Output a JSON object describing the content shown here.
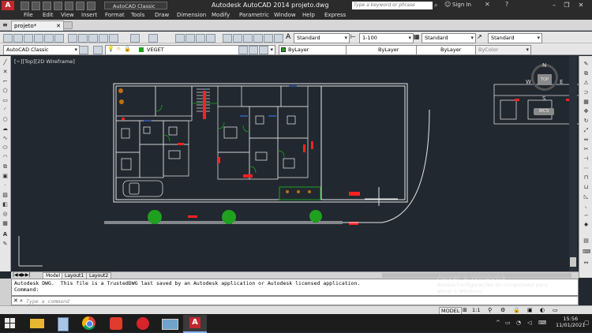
{
  "titlebar": {
    "title": "Autodesk AutoCAD 2014   projeto.dwg",
    "search_placeholder": "Type a keyword or phrase",
    "signin": "Sign In",
    "workspace": "AutoCAD Classic"
  },
  "menu": [
    "File",
    "Edit",
    "View",
    "Insert",
    "Format",
    "Tools",
    "Draw",
    "Dimension",
    "Modify",
    "Parametric",
    "Window",
    "Help",
    "Express"
  ],
  "doc_tab": "projeto*",
  "toolbar1": {
    "text_style": "Standard",
    "dim_scale": "1-100",
    "table_style": "Standard",
    "ml_style": "Standard"
  },
  "toolbar2": {
    "workspace": "AutoCAD Classic",
    "layer": "VEGET",
    "color": "ByLayer",
    "linetype": "ByLayer",
    "lineweight": "ByLayer",
    "plotstyle": "ByColor"
  },
  "viewport_label": "[−][Top][2D Wireframe]",
  "viewcube": {
    "n": "N",
    "s": "S",
    "e": "E",
    "w": "W",
    "top": "TOP",
    "wcs": "WCS"
  },
  "layout_tabs": [
    "Model",
    "Layout1",
    "Layout2"
  ],
  "command": {
    "history_line1": "Autodesk DWG.  This file is a TrustedDWG last saved by an Autodesk application or Autodesk licensed application.",
    "history_line2": "Command:",
    "placeholder": "Type a command"
  },
  "status": {
    "model": "MODEL",
    "scale": "1:1"
  },
  "watermark": {
    "title": "Ativar o Windows",
    "line1": "Acesse Configurações do computador para",
    "line2": "ativar o Windows."
  },
  "clock": {
    "time": "15:56",
    "date": "11/01/2021"
  },
  "colors": {
    "accent_red": "#ff2020",
    "wall_white": "#e8e8e8",
    "green": "#1fa01f",
    "canvas": "#212830"
  }
}
